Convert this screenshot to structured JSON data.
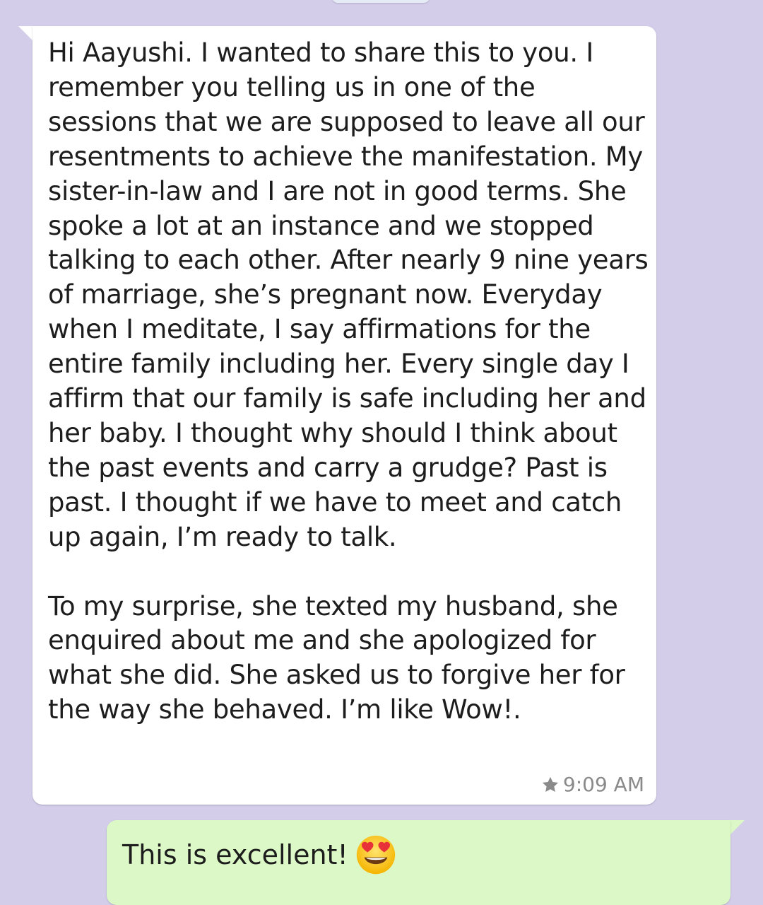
{
  "incoming_message": {
    "text": "Hi Aayushi. I wanted to share this to you. I remember you telling us in one of the sessions that we are supposed to leave all our resentments to achieve the manifestation. My sister-in-law and I are not in good terms. She spoke a lot at an instance and we stopped talking to each other. After nearly 9 nine years of marriage, she’s pregnant now. Everyday when I meditate, I say affirmations for the entire family including her. Every single day I affirm that our family is safe including her and her baby. I thought why should I think about the past events and carry a grudge? Past is past. I thought if we have to meet and catch up again, I’m ready to talk.\n\nTo my surprise, she texted my husband, she enquired about me and she apologized for what she did. She asked us to forgive her for the way she behaved. I’m like Wow!.",
    "time": "9:09 AM",
    "starred": true,
    "star_icon": "star-icon"
  },
  "outgoing_message": {
    "text": "This is excellent!",
    "emoji_icon": "heart-eyes-emoji-icon"
  },
  "colors": {
    "background": "#d3cdea",
    "incoming_bubble": "#ffffff",
    "outgoing_bubble": "#dcf8c6",
    "meta_text": "#8a8a8a"
  }
}
